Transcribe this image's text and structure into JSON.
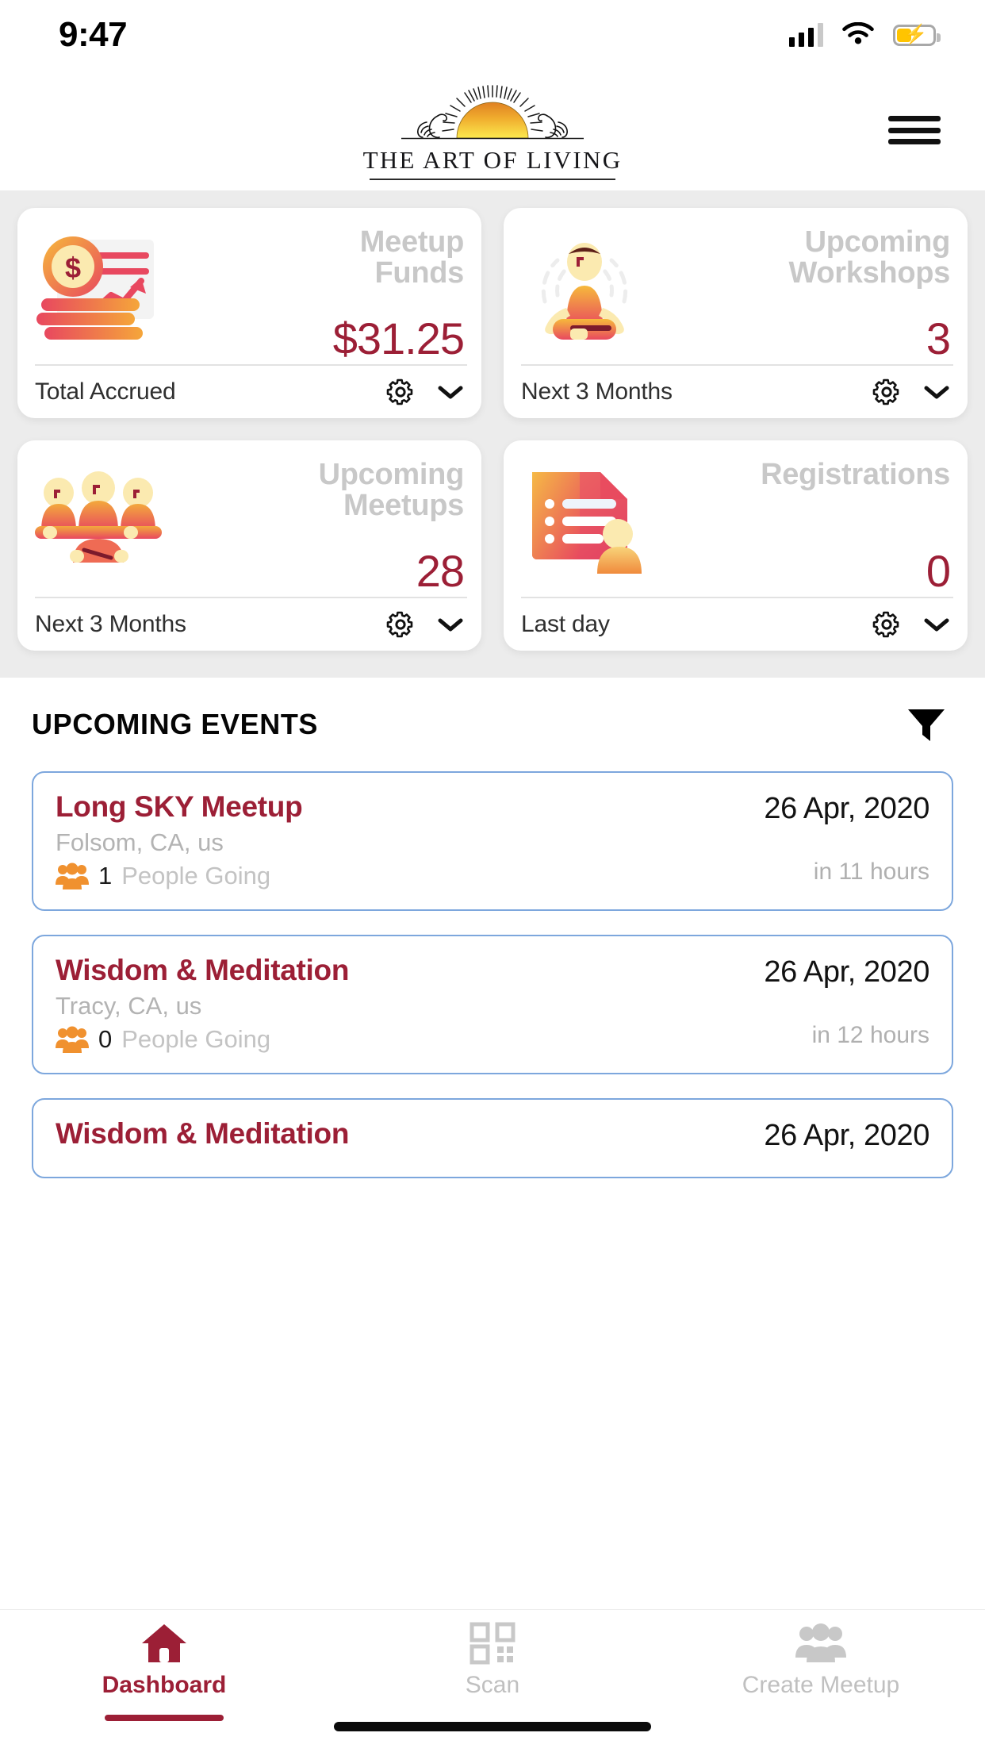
{
  "status_bar": {
    "time": "9:47",
    "signal_icon": "cellular-signal-icon",
    "wifi_icon": "wifi-icon",
    "battery_icon": "battery-charging-icon"
  },
  "header": {
    "logo_icon": "art-of-living-sun-swans-logo",
    "logo_text": "THE ART OF LIVING",
    "menu_icon": "hamburger-menu-icon"
  },
  "stats": [
    {
      "title": "Meetup Funds",
      "title_line1": "Meetup",
      "title_line2": "Funds",
      "value": "$31.25",
      "label": "Total Accrued",
      "illustration": "money-coins-chart-icon",
      "settings_icon": "gear-icon",
      "expand_icon": "chevron-down-icon"
    },
    {
      "title": "Upcoming Workshops",
      "title_line1": "Upcoming",
      "title_line2": "Workshops",
      "value": "3",
      "label": "Next 3 Months",
      "illustration": "meditation-person-icon",
      "settings_icon": "gear-icon",
      "expand_icon": "chevron-down-icon"
    },
    {
      "title": "Upcoming Meetups",
      "title_line1": "Upcoming",
      "title_line2": "Meetups",
      "value": "28",
      "label": "Next 3 Months",
      "illustration": "group-of-people-icon",
      "settings_icon": "gear-icon",
      "expand_icon": "chevron-down-icon"
    },
    {
      "title": "Registrations",
      "title_line1": "Registrations",
      "title_line2": "",
      "value": "0",
      "label": "Last day",
      "illustration": "registration-form-icon",
      "settings_icon": "gear-icon",
      "expand_icon": "chevron-down-icon"
    }
  ],
  "events_section": {
    "heading": "UPCOMING EVENTS",
    "filter_icon": "filter-funnel-icon",
    "going_label": "People Going",
    "items": [
      {
        "name": "Long SKY Meetup",
        "location": "Folsom, CA, us",
        "attendees": "1",
        "going_label": "People Going",
        "date": "26 Apr, 2020",
        "relative": "in 11 hours",
        "people_icon": "people-group-icon"
      },
      {
        "name": "Wisdom & Meditation",
        "location": "Tracy, CA, us",
        "attendees": "0",
        "going_label": "People Going",
        "date": "26 Apr, 2020",
        "relative": "in 12 hours",
        "people_icon": "people-group-icon"
      },
      {
        "name": "Wisdom & Meditation",
        "location": "",
        "attendees": "",
        "going_label": "",
        "date": "26 Apr, 2020",
        "relative": "",
        "people_icon": "people-group-icon"
      }
    ]
  },
  "tabbar": {
    "items": [
      {
        "label": "Dashboard",
        "icon": "home-icon",
        "active": true
      },
      {
        "label": "Scan",
        "icon": "qr-code-icon",
        "active": false
      },
      {
        "label": "Create Meetup",
        "icon": "people-group-icon",
        "active": false
      }
    ]
  },
  "colors": {
    "brand_red": "#9c1f36",
    "muted_gray": "#c8c8c8",
    "card_border_blue": "#7da7dd",
    "page_gray": "#ececec",
    "accent_orange": "#f0912f"
  }
}
